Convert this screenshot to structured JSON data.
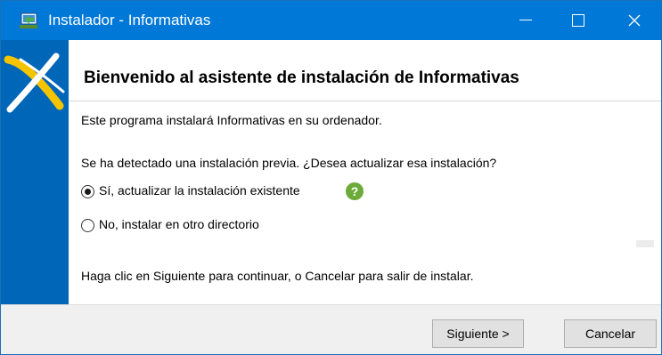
{
  "window": {
    "title": "Instalador - Informativas"
  },
  "header": {
    "title": "Bienvenido al asistente de instalación de Informativas"
  },
  "content": {
    "intro": "Este programa instalará Informativas en su ordenador.",
    "question": "Se ha detectado una instalación previa. ¿Desea actualizar esa instalación?",
    "options": [
      {
        "label": "Sí, actualizar la instalación existente",
        "selected": true
      },
      {
        "label": "No, instalar en otro directorio",
        "selected": false
      }
    ],
    "help_icon_glyph": "?",
    "footer_note": "Haga clic en Siguiente para continuar, o Cancelar para salir de instalar."
  },
  "buttons": {
    "next": "Siguiente >",
    "cancel": "Cancelar"
  },
  "colors": {
    "titlebar": "#0078d7",
    "logo_background": "#0066b8",
    "logo_accent": "#f5c400",
    "help_icon": "#6cab3a"
  }
}
